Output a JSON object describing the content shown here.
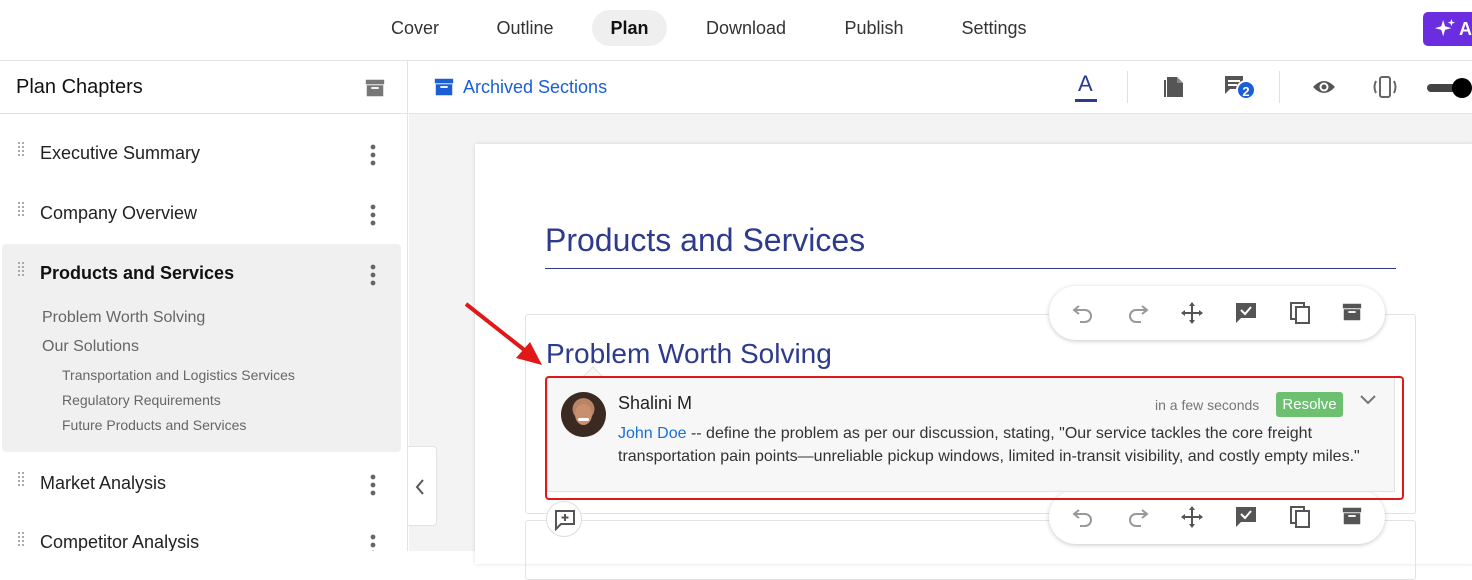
{
  "nav": {
    "tabs": [
      {
        "label": "Cover"
      },
      {
        "label": "Outline"
      },
      {
        "label": "Plan"
      },
      {
        "label": "Download"
      },
      {
        "label": "Publish"
      },
      {
        "label": "Settings"
      }
    ],
    "active_tab": "Plan",
    "ai_button_label": "A"
  },
  "sidebar": {
    "title": "Plan Chapters",
    "chapters": [
      {
        "label": "Executive Summary"
      },
      {
        "label": "Company Overview"
      },
      {
        "label": "Products and Services"
      },
      {
        "label": "Market Analysis"
      },
      {
        "label": "Competitor Analysis"
      }
    ],
    "active_subsections": {
      "level1": [
        "Problem Worth Solving",
        "Our Solutions"
      ],
      "level2": [
        "Transportation and Logistics Services",
        "Regulatory Requirements",
        "Future Products and Services"
      ]
    }
  },
  "toolbar": {
    "archived_label": "Archived Sections",
    "text_style_glyph": "A",
    "comments_count": "2"
  },
  "document": {
    "title": "Products and Services",
    "section_title": "Problem Worth Solving"
  },
  "comment": {
    "author": "Shalini M",
    "time": "in a few seconds",
    "resolve_label": "Resolve",
    "mention": "John Doe",
    "text": " -- define the problem as per our discussion, stating, \"Our service tackles the core freight transportation pain points—unreliable pickup windows, limited in-transit visibility, and costly empty miles.\""
  },
  "colors": {
    "accent": "#2e3a8c",
    "link": "#1a5fd6",
    "resolve": "#6cc070",
    "highlight": "#e01818",
    "ai_button": "#6a2ee0"
  }
}
